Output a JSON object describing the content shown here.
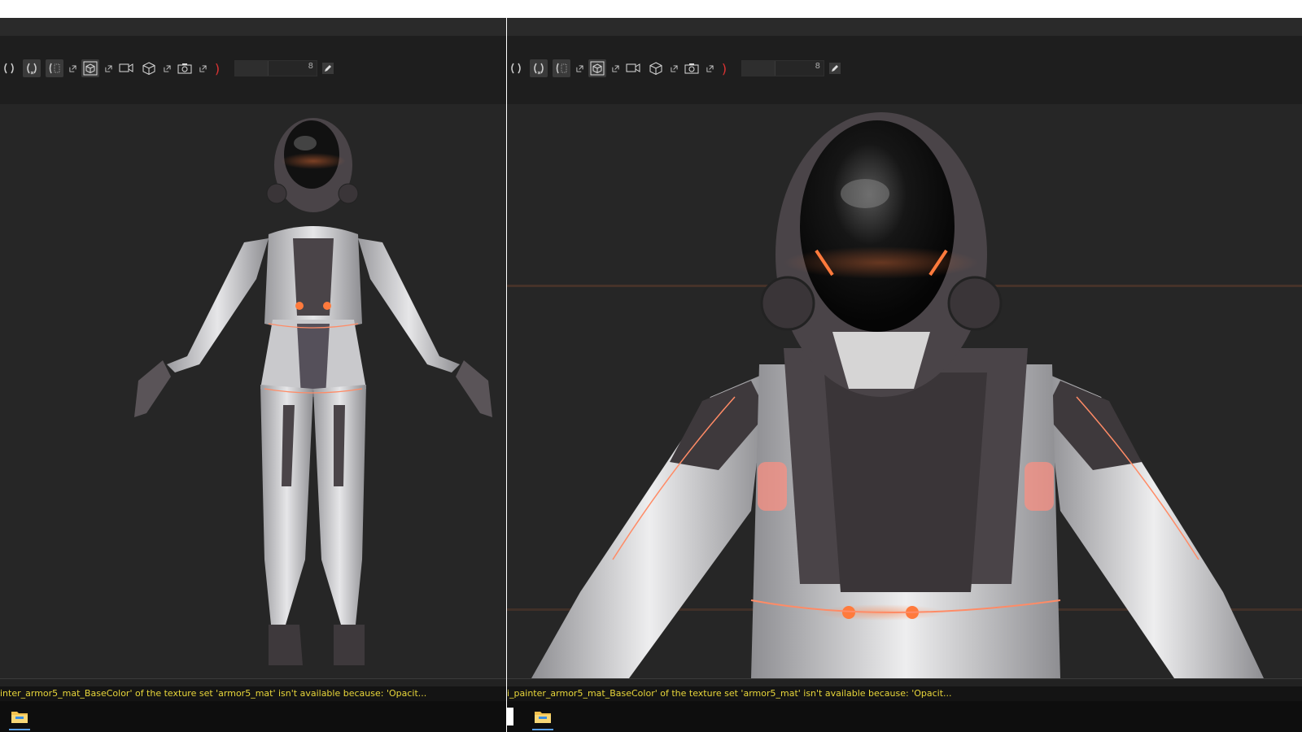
{
  "panels": [
    {
      "id": "left",
      "toolbar": {
        "field_value": "8"
      },
      "log_message": "inter_armor5_mat_BaseColor' of the texture set 'armor5_mat' isn't available because: 'Opacit..."
    },
    {
      "id": "right",
      "toolbar": {
        "field_value": "8"
      },
      "log_message": "i_painter_armor5_mat_BaseColor' of the texture set 'armor5_mat' isn't available because: 'Opacit..."
    }
  ],
  "icons": {
    "toolbar": [
      "mirror-icon",
      "mirror-x-icon",
      "mirror-pattern-icon",
      "cube-select-icon",
      "camera-video-icon",
      "cube-icon",
      "screenshot-camera-icon",
      "red-bracket-icon",
      "pencil-icon"
    ],
    "taskbar": [
      "file-explorer-icon"
    ]
  },
  "colors": {
    "log_text": "#e8d63a",
    "viewport_bg": "#262626",
    "accent_glow": "#ff7a3c",
    "taskbar_highlight": "#5aa0e6"
  }
}
